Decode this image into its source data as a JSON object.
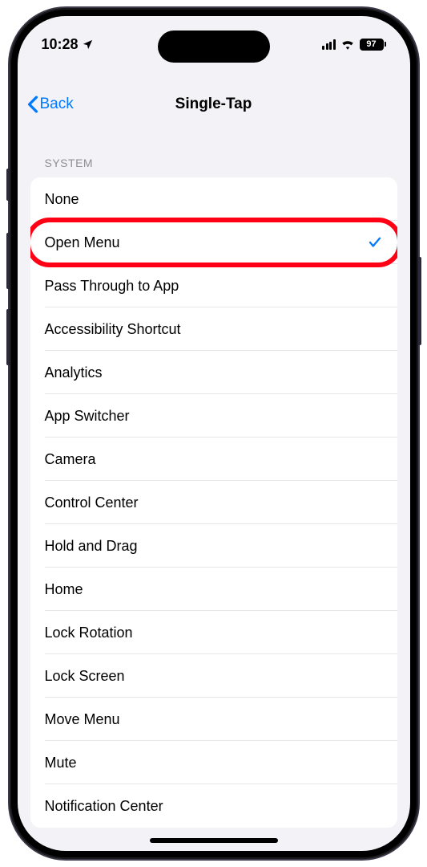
{
  "status": {
    "time": "10:28",
    "battery": "97"
  },
  "nav": {
    "back_label": "Back",
    "title": "Single-Tap"
  },
  "section": {
    "header": "SYSTEM"
  },
  "options": [
    {
      "label": "None",
      "selected": false,
      "highlighted": false
    },
    {
      "label": "Open Menu",
      "selected": true,
      "highlighted": true
    },
    {
      "label": "Pass Through to App",
      "selected": false,
      "highlighted": false
    },
    {
      "label": "Accessibility Shortcut",
      "selected": false,
      "highlighted": false
    },
    {
      "label": "Analytics",
      "selected": false,
      "highlighted": false
    },
    {
      "label": "App Switcher",
      "selected": false,
      "highlighted": false
    },
    {
      "label": "Camera",
      "selected": false,
      "highlighted": false
    },
    {
      "label": "Control Center",
      "selected": false,
      "highlighted": false
    },
    {
      "label": "Hold and Drag",
      "selected": false,
      "highlighted": false
    },
    {
      "label": "Home",
      "selected": false,
      "highlighted": false
    },
    {
      "label": "Lock Rotation",
      "selected": false,
      "highlighted": false
    },
    {
      "label": "Lock Screen",
      "selected": false,
      "highlighted": false
    },
    {
      "label": "Move Menu",
      "selected": false,
      "highlighted": false
    },
    {
      "label": "Mute",
      "selected": false,
      "highlighted": false
    },
    {
      "label": "Notification Center",
      "selected": false,
      "highlighted": false
    }
  ]
}
